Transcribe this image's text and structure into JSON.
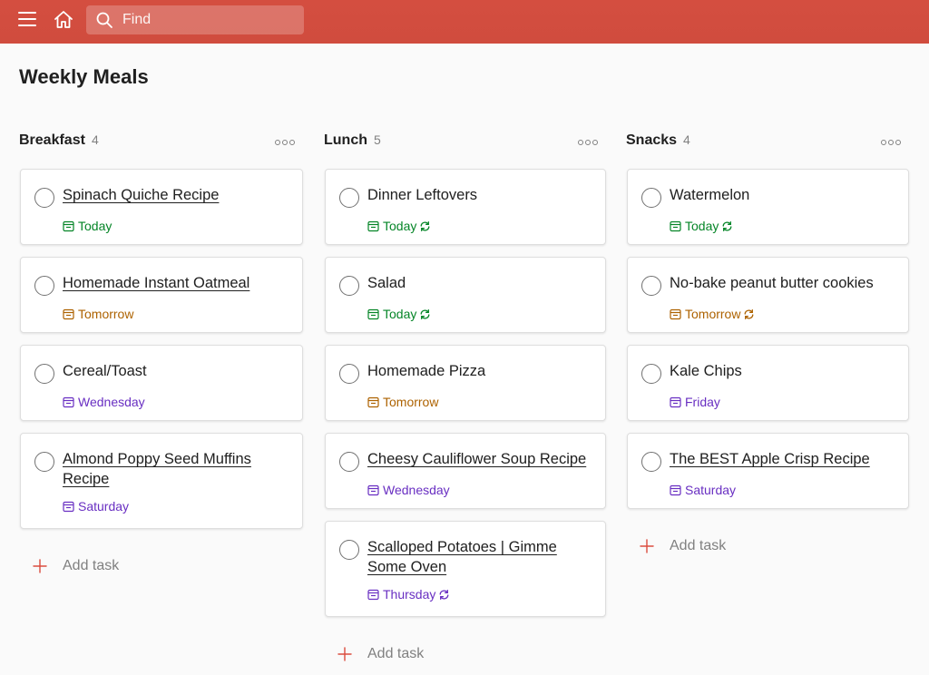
{
  "header": {
    "search_placeholder": "Find",
    "accent": "#d44e40"
  },
  "page": {
    "title": "Weekly Meals"
  },
  "colors": {
    "today": "#058527",
    "tomorrow": "#ad6200",
    "weekday": "#692fc2"
  },
  "columns": [
    {
      "name": "Breakfast",
      "count": "4",
      "tasks": [
        {
          "title": "Spinach Quiche Recipe",
          "link": true,
          "due": "Today",
          "type": "today",
          "recurring": false
        },
        {
          "title": "Homemade Instant Oatmeal",
          "link": true,
          "due": "Tomorrow",
          "type": "tomorrow",
          "recurring": false
        },
        {
          "title": "Cereal/Toast",
          "link": false,
          "due": "Wednesday",
          "type": "weekday",
          "recurring": false
        },
        {
          "title": "Almond Poppy Seed Muffins Recipe",
          "link": true,
          "due": "Saturday",
          "type": "weekday",
          "recurring": false
        }
      ],
      "add_label": "Add task"
    },
    {
      "name": "Lunch",
      "count": "5",
      "tasks": [
        {
          "title": "Dinner Leftovers",
          "link": false,
          "due": "Today",
          "type": "today",
          "recurring": true
        },
        {
          "title": "Salad",
          "link": false,
          "due": "Today",
          "type": "today",
          "recurring": true
        },
        {
          "title": "Homemade Pizza",
          "link": false,
          "due": "Tomorrow",
          "type": "tomorrow",
          "recurring": false
        },
        {
          "title": "Cheesy Cauliflower Soup Recipe",
          "link": true,
          "due": "Wednesday",
          "type": "weekday",
          "recurring": false
        },
        {
          "title": "Scalloped Potatoes | Gimme Some Oven",
          "link": true,
          "due": "Thursday",
          "type": "weekday",
          "recurring": true
        }
      ],
      "add_label": "Add task"
    },
    {
      "name": "Snacks",
      "count": "4",
      "tasks": [
        {
          "title": "Watermelon",
          "link": false,
          "due": "Today",
          "type": "today",
          "recurring": true
        },
        {
          "title": "No-bake peanut butter cookies",
          "link": false,
          "due": "Tomorrow",
          "type": "tomorrow",
          "recurring": true
        },
        {
          "title": "Kale Chips",
          "link": false,
          "due": "Friday",
          "type": "weekday",
          "recurring": false
        },
        {
          "title": "The BEST Apple Crisp Recipe",
          "link": true,
          "due": "Saturday",
          "type": "weekday",
          "recurring": false
        }
      ],
      "add_label": "Add task"
    }
  ]
}
